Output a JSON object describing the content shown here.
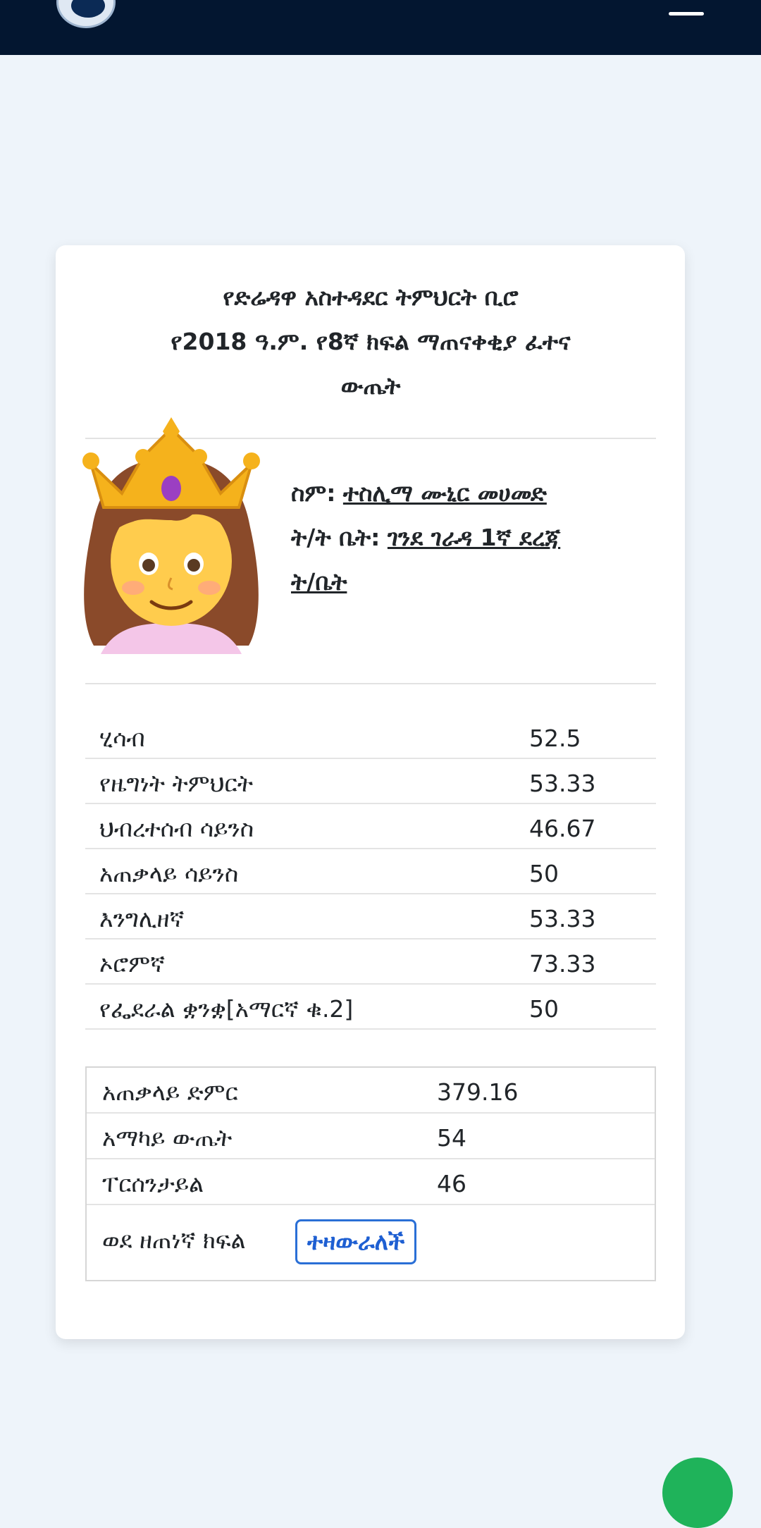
{
  "header": {
    "line1": "የድሬዳዋ አስተዳደር ትምህርት ቢሮ",
    "line2": "የ2018 ዓ.ም. የ8ኛ ክፍል ማጠናቀቂያ ፈተና",
    "line3": "ውጤት"
  },
  "student": {
    "avatar_icon": "princess-emoji-icon",
    "name_label": "ስም:",
    "name": "ተስሊማ ሙኒር መሀመድ",
    "school_label": "ት/ት ቤት:",
    "school_line1": "ገንደ ገራዳ 1ኛ ደረጃ",
    "school_line2": "ት/ቤት"
  },
  "subjects": [
    {
      "name": "ሂሳብ",
      "score": "52.5"
    },
    {
      "name": "የዜግነት ትምህርት",
      "score": "53.33"
    },
    {
      "name": "ህብረተሰብ ሳይንስ",
      "score": "46.67"
    },
    {
      "name": "አጠቃላይ ሳይንስ",
      "score": "50"
    },
    {
      "name": "እንግሊዘኛ",
      "score": "53.33"
    },
    {
      "name": "ኦሮምኛ",
      "score": "73.33"
    },
    {
      "name": "የፌደራል ቋንቋ[አማርኛ ቁ.2]",
      "score": "50"
    }
  ],
  "summary": {
    "total_label": "አጠቃላይ ድምር",
    "total": "379.16",
    "average_label": "አማካይ ውጤት",
    "average": "54",
    "percentile_label": "ፐርሰንታይል",
    "percentile": "46",
    "promotion_label": "ወደ ዘጠነኛ ክፍል",
    "promotion_status": "ተዛውራለች"
  },
  "colors": {
    "navbar": "#031630",
    "page_background": "#eef4fa",
    "status_accent": "#1e5fd2",
    "fab": "#1fb35a"
  }
}
